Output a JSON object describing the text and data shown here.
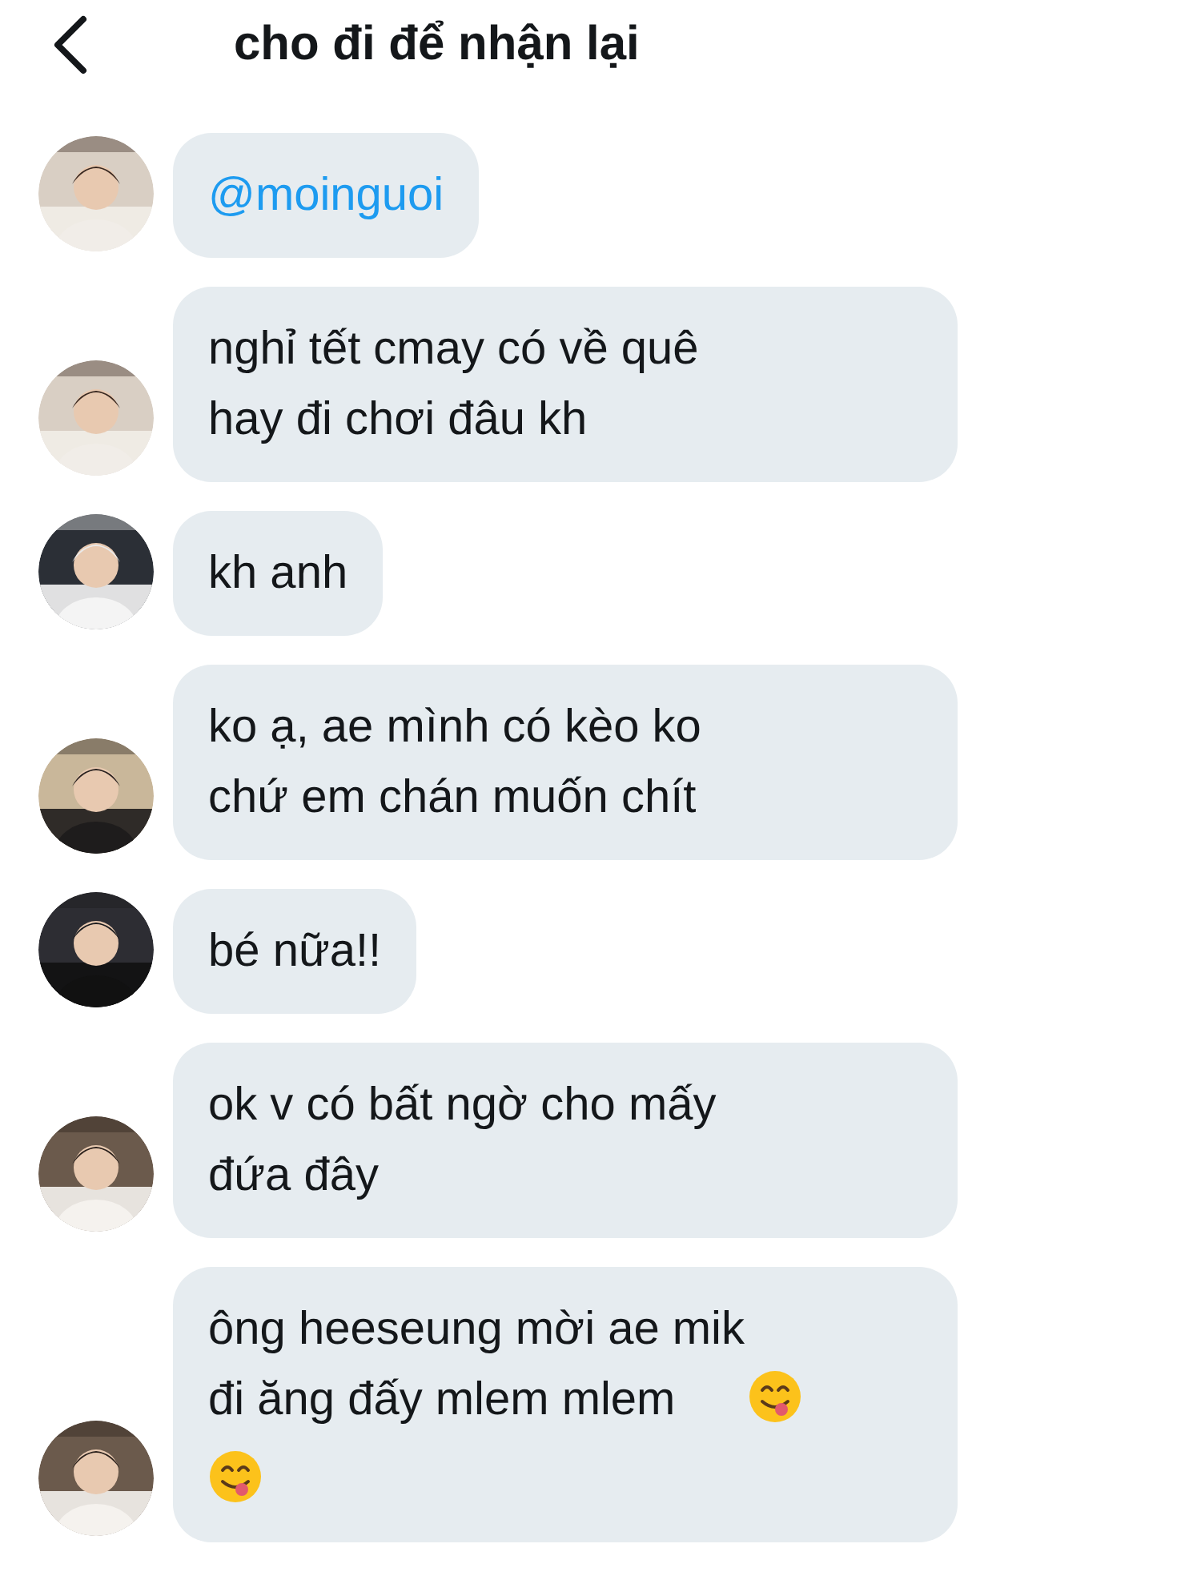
{
  "header": {
    "title": "cho đi để nhận lại"
  },
  "messages": [
    {
      "kind": "mention",
      "lines": [
        "@moinguoi"
      ]
    },
    {
      "kind": "text",
      "lines": [
        "nghỉ tết cmay có về quê",
        "hay đi chơi đâu kh"
      ]
    },
    {
      "kind": "text",
      "lines": [
        "kh anh"
      ]
    },
    {
      "kind": "text",
      "lines": [
        "ko ạ, ae mình có kèo ko",
        "chứ em chán muốn chít"
      ]
    },
    {
      "kind": "text",
      "lines": [
        "bé nữa!!"
      ]
    },
    {
      "kind": "text",
      "lines": [
        "ok v có bất ngờ cho mấy",
        "đứa đây"
      ]
    },
    {
      "kind": "text",
      "lines": [
        "ông heeseung mời ae mik",
        "đi ăng đấy mlem mlem"
      ],
      "emojis": [
        {
          "kind": "tongue-smile"
        },
        {
          "kind": "tongue-smile"
        }
      ]
    }
  ]
}
